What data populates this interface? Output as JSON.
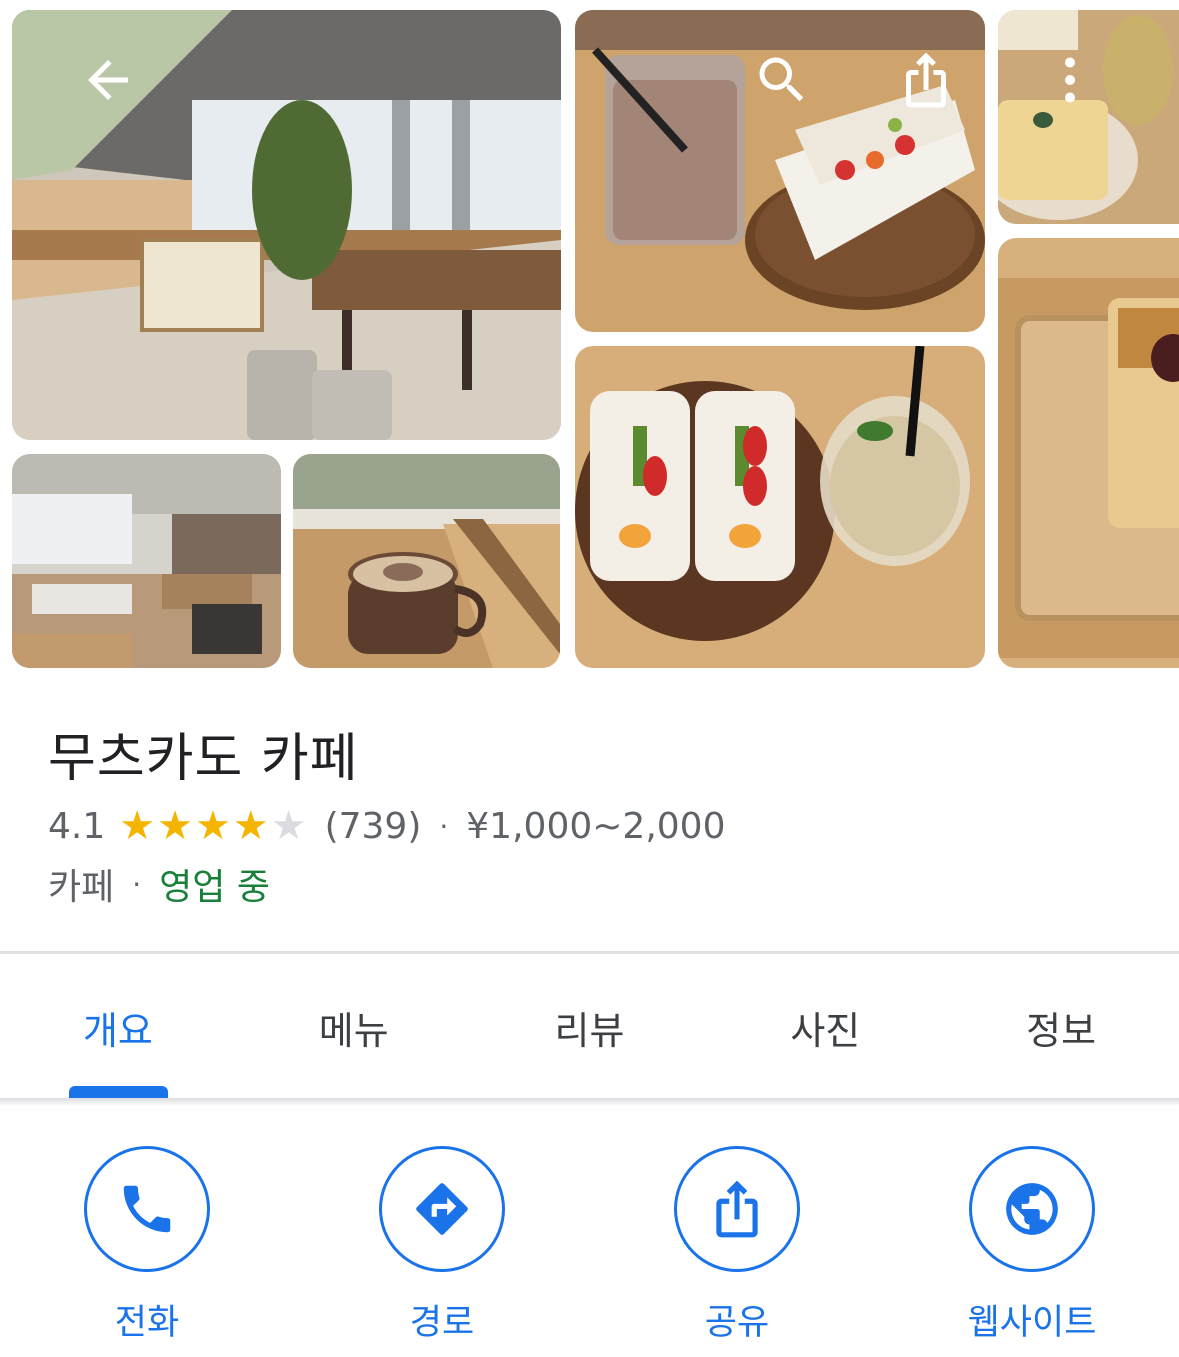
{
  "header": {
    "back_icon": "arrow-back-icon",
    "search_icon": "search-icon",
    "share_icon": "share-icon",
    "more_icon": "more-vert-icon"
  },
  "gallery": {
    "photos": [
      "cafe-interior",
      "cafe-seating",
      "coffee-cup",
      "latte-and-sandwich",
      "fruit-sandwich-and-drink",
      "toast-plate",
      "toast-closeup"
    ]
  },
  "place": {
    "name": "무츠카도 카페",
    "rating": "4.1",
    "stars_filled": 4,
    "stars_total": 5,
    "review_count": "(739)",
    "separator": "·",
    "price_range": "¥1,000~2,000",
    "category": "카페",
    "status": "영업 중"
  },
  "tabs": [
    {
      "label": "개요",
      "active": true
    },
    {
      "label": "메뉴",
      "active": false
    },
    {
      "label": "리뷰",
      "active": false
    },
    {
      "label": "사진",
      "active": false
    },
    {
      "label": "정보",
      "active": false
    }
  ],
  "actions": [
    {
      "label": "전화",
      "icon": "phone-icon"
    },
    {
      "label": "경로",
      "icon": "directions-icon"
    },
    {
      "label": "공유",
      "icon": "share-icon"
    },
    {
      "label": "웹사이트",
      "icon": "globe-icon"
    }
  ],
  "colors": {
    "accent": "#1a73e8",
    "star": "#f4b400",
    "open": "#188038",
    "text_secondary": "#5f6368"
  }
}
